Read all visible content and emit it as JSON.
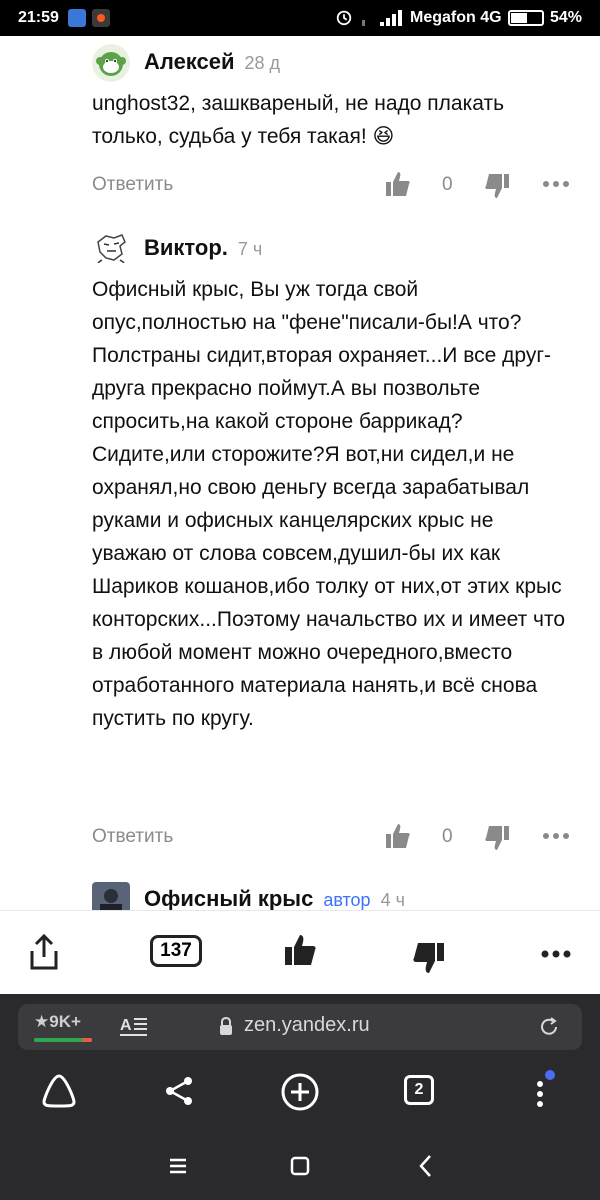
{
  "status_bar": {
    "time": "21:59",
    "carrier": "Megafon 4G",
    "battery_percent": "54%",
    "battery_level": 0.54
  },
  "comments": [
    {
      "author": "Алексей",
      "age": "28 д",
      "text": "unghost32, зашквареный, не надо плакать только, судьба у тебя такая! 😆",
      "reply_label": "Ответить",
      "likes": "0"
    },
    {
      "author": "Виктор.",
      "age": "7 ч",
      "text": "Офисный крыс, Вы уж тогда свой опус,полностью на \"фене\"писали-бы!А что?Полстраны сидит,вторая охраняет...И все друг-друга прекрасно поймут.А вы позвольте спросить,на какой стороне баррикад?Сидите,или сторожите?Я вот,ни сидел,и не охранял,но свою деньгу всегда зарабатывал руками и офисных канцелярских крыс не уважаю от слова совсем,душил-бы их как Шариков кошанов,ибо толку от них,от этих крыс конторских...Поэтому начальство их и имеет что в любой момент можно очередного,вместо отработанного материала нанять,и всё снова пустить по кругу.",
      "reply_label": "Ответить",
      "likes": "0"
    },
    {
      "author": "Офисный крыс",
      "badge": "автор",
      "age": "4 ч"
    }
  ],
  "action_bar": {
    "comments_count": "137"
  },
  "browser": {
    "stars_label": "★9K+",
    "url": "zen.yandex.ru",
    "tabs_count": "2"
  },
  "colors": {
    "link_blue": "#3b73ff",
    "muted_gray": "#8a8a8a",
    "browser_bg": "#2a2a2c"
  }
}
